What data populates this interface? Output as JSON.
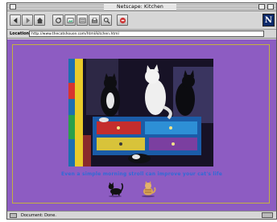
{
  "window": {
    "title": "Netscape: Kitchen"
  },
  "toolbar": {
    "buttons": [
      {
        "name": "back-button",
        "icon": "back-arrow-icon"
      },
      {
        "name": "forward-button",
        "icon": "forward-arrow-icon"
      },
      {
        "name": "home-button",
        "icon": "home-icon"
      },
      {
        "name": "reload-button",
        "icon": "reload-icon"
      },
      {
        "name": "images-button",
        "icon": "images-icon"
      },
      {
        "name": "open-button",
        "icon": "open-icon"
      },
      {
        "name": "print-button",
        "icon": "print-icon"
      },
      {
        "name": "find-button",
        "icon": "find-icon"
      },
      {
        "name": "stop-button",
        "icon": "stop-icon"
      }
    ],
    "logo": "N"
  },
  "location": {
    "label": "Location:",
    "url": "http://www.thecatshouse.com/html/kitchen.html"
  },
  "content": {
    "caption": "Even a simple morning stroll can improve your cat's life",
    "photo_icon": "cats-on-dresser-photo",
    "cat_icons": [
      "black-cat-icon",
      "tabby-cat-icon"
    ]
  },
  "status": {
    "text": "Document: Done."
  },
  "colors": {
    "page_background": "#8d5cc2",
    "frame_border": "#c4b13f",
    "caption": "#2f6bd6",
    "logo_background": "#0d2a6b"
  }
}
